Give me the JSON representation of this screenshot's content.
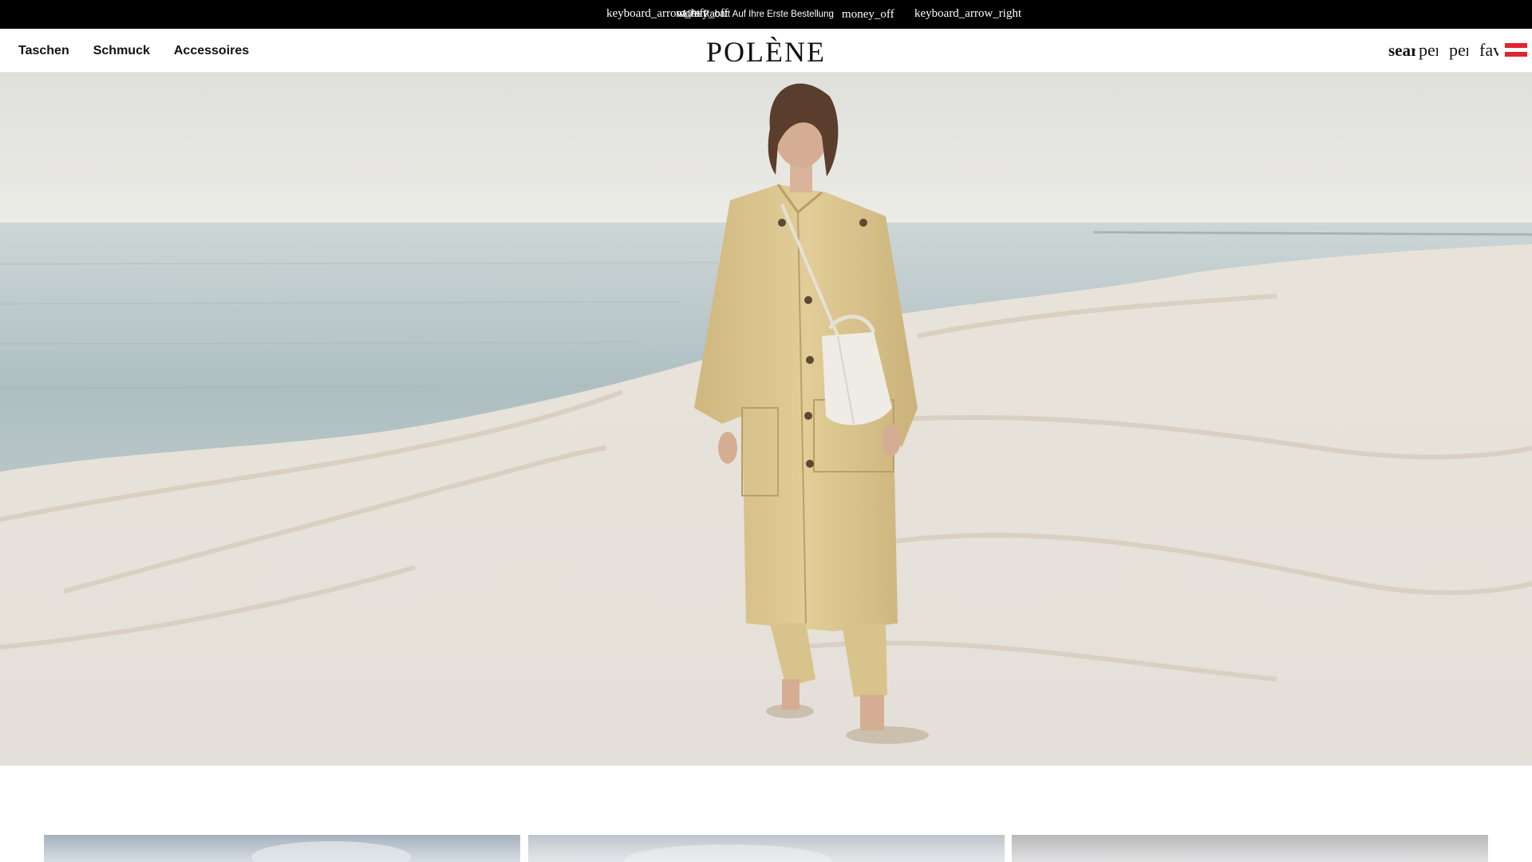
{
  "promo": {
    "arrow_left_icon": "keyboard_arrow_left",
    "arrow_left_label": "keyboard_arrow_left",
    "money_icon": "money_off",
    "money_icon_label": "money_off",
    "message": "10% Rabatt Auf Ihre Erste Bestellung",
    "arrow_right_icon": "keyboard_arrow_right",
    "arrow_right_label": "keyboard_arrow_right"
  },
  "header": {
    "nav": [
      {
        "label": "Taschen"
      },
      {
        "label": "Schmuck"
      },
      {
        "label": "Accessoires"
      }
    ],
    "logo": "POLÈNE",
    "tools": {
      "search_label": "search",
      "person_label": "person",
      "bag_label": "person",
      "favorite_label": "favorite"
    },
    "flag_icon": "austria-flag-icon"
  },
  "hero": {
    "image_icon": "hero-photo-woman-on-salt-shore",
    "colors": {
      "sky": "#e9e9e4",
      "sea": "#b9c8c9",
      "salt": "#ece7de",
      "coat": "#dcc690"
    }
  },
  "tiles": {
    "items": [
      {
        "icon": "category-image-1"
      },
      {
        "icon": "category-image-2"
      },
      {
        "icon": "category-image-3"
      }
    ]
  }
}
